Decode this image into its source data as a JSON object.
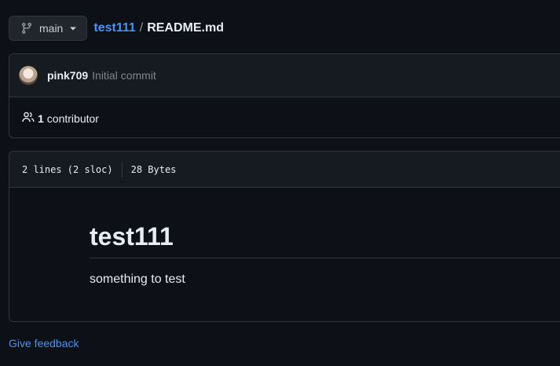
{
  "branch": {
    "name": "main",
    "icon": "git-branch-icon",
    "dropdown_icon": "triangle-down-icon"
  },
  "breadcrumb": {
    "repo": "test111",
    "separator": "/",
    "file": "README.md"
  },
  "commit": {
    "author": "pink709",
    "message": "Initial commit"
  },
  "contributors": {
    "count": "1",
    "label": "contributor",
    "icon": "people-icon"
  },
  "file_info": {
    "lines": "2 lines (2 sloc)",
    "size": "28 Bytes"
  },
  "readme": {
    "heading": "test111",
    "body": "something to test"
  },
  "footer": {
    "feedback_link": "Give feedback"
  },
  "colors": {
    "background": "#0d1117",
    "link": "#4493f8",
    "border": "#30363d",
    "header_bg": "#161b22",
    "muted": "#7d8590"
  }
}
